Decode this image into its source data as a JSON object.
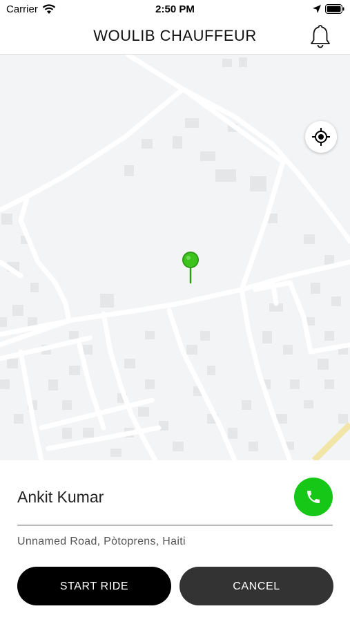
{
  "status_bar": {
    "carrier": "Carrier",
    "time": "2:50 PM"
  },
  "header": {
    "title": "WOULIB CHAUFFEUR",
    "notification_icon": "bell-icon"
  },
  "map": {
    "locate_icon": "crosshair-icon",
    "pin_icon": "map-pin-icon",
    "pin_color": "#3cc41d",
    "chat_icon": "chat-bubble-icon"
  },
  "ride": {
    "rider_name": "Ankit Kumar",
    "call_icon": "phone-icon",
    "call_color": "#16c718",
    "address": "Unnamed Road, Pòtoprens, Haiti"
  },
  "actions": {
    "start_label": "START RIDE",
    "cancel_label": "CANCEL"
  }
}
